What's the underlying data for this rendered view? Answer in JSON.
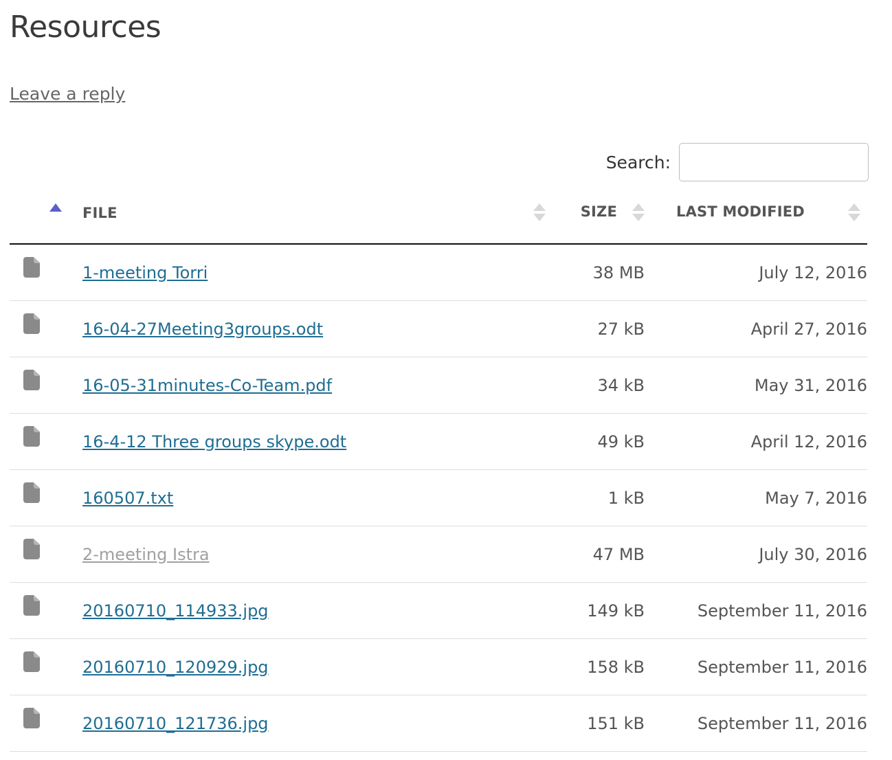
{
  "page": {
    "title": "Resources",
    "reply_link": "Leave a reply"
  },
  "search": {
    "label": "Search:",
    "value": "",
    "placeholder": ""
  },
  "table": {
    "columns": {
      "file": "FILE",
      "size": "SIZE",
      "last_modified": "LAST MODIFIED"
    },
    "sort": {
      "column": "icon",
      "direction": "ascending"
    },
    "rows": [
      {
        "icon": "document-icon",
        "name": "1-meeting Torri",
        "size": "38 MB",
        "modified": "July 12, 2016",
        "visited": false
      },
      {
        "icon": "document-icon",
        "name": "16-04-27Meeting3groups.odt",
        "size": "27 kB",
        "modified": "April 27, 2016",
        "visited": false
      },
      {
        "icon": "document-icon",
        "name": "16-05-31minutes-Co-Team.pdf",
        "size": "34 kB",
        "modified": "May 31, 2016",
        "visited": false
      },
      {
        "icon": "document-icon",
        "name": "16-4-12 Three groups skype.odt",
        "size": "49 kB",
        "modified": "April 12, 2016",
        "visited": false
      },
      {
        "icon": "document-icon",
        "name": "160507.txt",
        "size": "1 kB",
        "modified": "May 7, 2016",
        "visited": false
      },
      {
        "icon": "document-icon",
        "name": "2-meeting Istra",
        "size": "47 MB",
        "modified": "July 30, 2016",
        "visited": true
      },
      {
        "icon": "document-icon",
        "name": "20160710_114933.jpg",
        "size": "149 kB",
        "modified": "September 11, 2016",
        "visited": false
      },
      {
        "icon": "document-icon",
        "name": "20160710_120929.jpg",
        "size": "158 kB",
        "modified": "September 11, 2016",
        "visited": false
      },
      {
        "icon": "document-icon",
        "name": "20160710_121736.jpg",
        "size": "151 kB",
        "modified": "September 11, 2016",
        "visited": false
      }
    ]
  },
  "colors": {
    "link": "#1f6d93",
    "visited_link": "#a0a0a0",
    "sort_active": "#5b5fc7",
    "sort_inactive": "#d8d8d8",
    "file_icon": "#8a8a8a"
  }
}
